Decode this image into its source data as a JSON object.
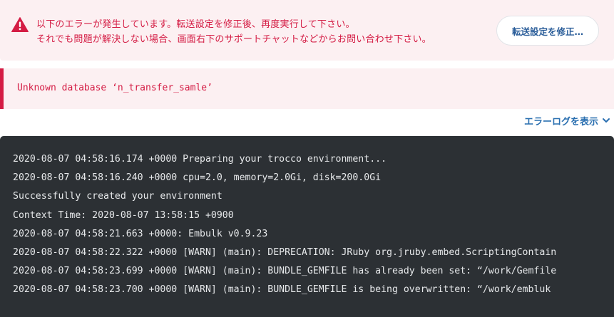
{
  "alert": {
    "icon": "warning-triangle-icon",
    "lines": [
      "以下のエラーが発生しています。転送設定を修正後、再度実行して下さい。",
      "それでも問題が解決しない場合、画面右下のサポートチャットなどからお問い合わせ下さい。"
    ],
    "fix_button_label": "転送設定を修正…",
    "color": "#d41c44"
  },
  "error_message": {
    "text": "Unknown database ‘n_transfer_samle’"
  },
  "log_toggle": {
    "label": "エラーログを表示",
    "icon": "chevron-down-icon"
  },
  "console": {
    "lines": [
      "2020-08-07 04:58:16.174 +0000 Preparing your trocco environment...",
      "2020-08-07 04:58:16.240 +0000 cpu=2.0, memory=2.0Gi, disk=200.0Gi",
      "Successfully created your environment",
      "Context Time: 2020-08-07 13:58:15 +0900",
      "2020-08-07 04:58:21.663 +0000: Embulk v0.9.23",
      "2020-08-07 04:58:22.322 +0000 [WARN] (main): DEPRECATION: JRuby org.jruby.embed.ScriptingContain",
      "2020-08-07 04:58:23.699 +0000 [WARN] (main): BUNDLE_GEMFILE has already been set: “/work/Gemfile",
      "2020-08-07 04:58:23.700 +0000 [WARN] (main): BUNDLE_GEMFILE is being overwritten: “/work/embluk"
    ]
  }
}
